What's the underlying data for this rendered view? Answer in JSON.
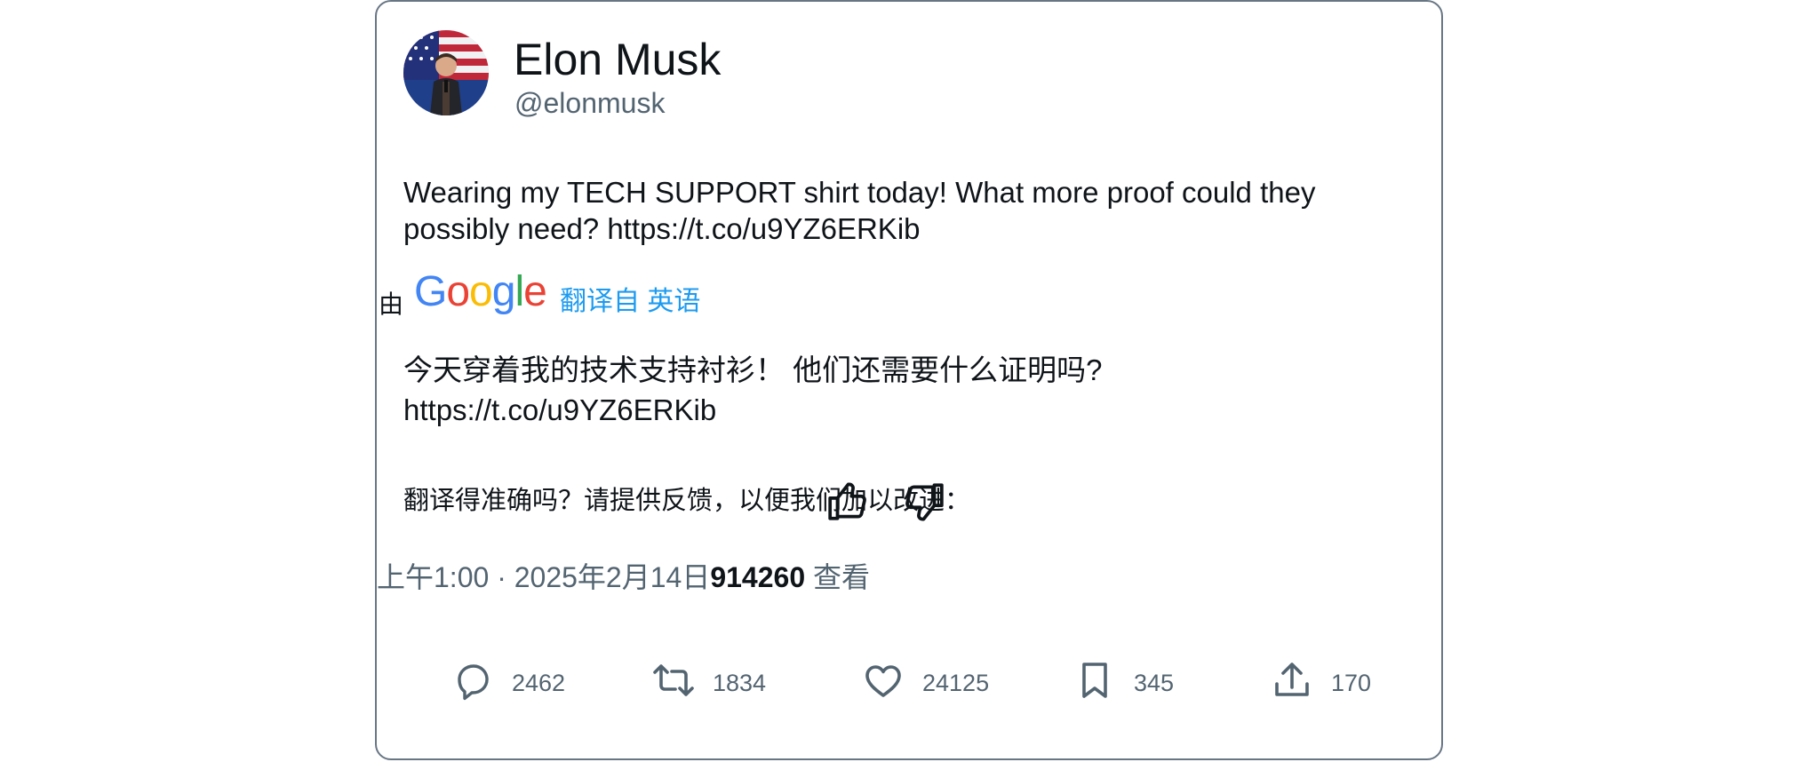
{
  "author": {
    "display_name": "Elon Musk",
    "handle": "@elonmusk"
  },
  "tweet": {
    "text": "Wearing my TECH SUPPORT shirt today! What more proof could they possibly need? ",
    "link": "https://t.co/u9YZ6ERKib"
  },
  "translation": {
    "by_label": "由",
    "provider_logo_text": "Google",
    "translated_from": "翻译自 英语",
    "text": "今天穿着我的技术支持衬衫！ 他们还需要什么证明吗?",
    "link": "https://t.co/u9YZ6ERKib",
    "feedback_prompt": "翻译得准确吗？请提供反馈，以便我们加以改进："
  },
  "meta": {
    "time": "上午1:00",
    "separator": "·",
    "date": "2025年2月14日",
    "views_count": "914260",
    "views_label": " 查看"
  },
  "actions": {
    "replies": "2462",
    "retweets": "1834",
    "likes": "24125",
    "bookmarks": "345",
    "shares": "170"
  },
  "colors": {
    "text_primary": "#0f1419",
    "text_secondary": "#536471",
    "link_blue": "#1d9bf0",
    "border": "#687684",
    "google_blue": "#4285f4",
    "google_red": "#ea4335",
    "google_yellow": "#fbbc05",
    "google_green": "#34a853"
  },
  "icons": {
    "reply": "reply-icon",
    "retweet": "retweet-icon",
    "like": "heart-icon",
    "bookmark": "bookmark-icon",
    "share": "share-icon",
    "thumbs_up": "thumbs-up-icon",
    "thumbs_down": "thumbs-down-icon"
  }
}
